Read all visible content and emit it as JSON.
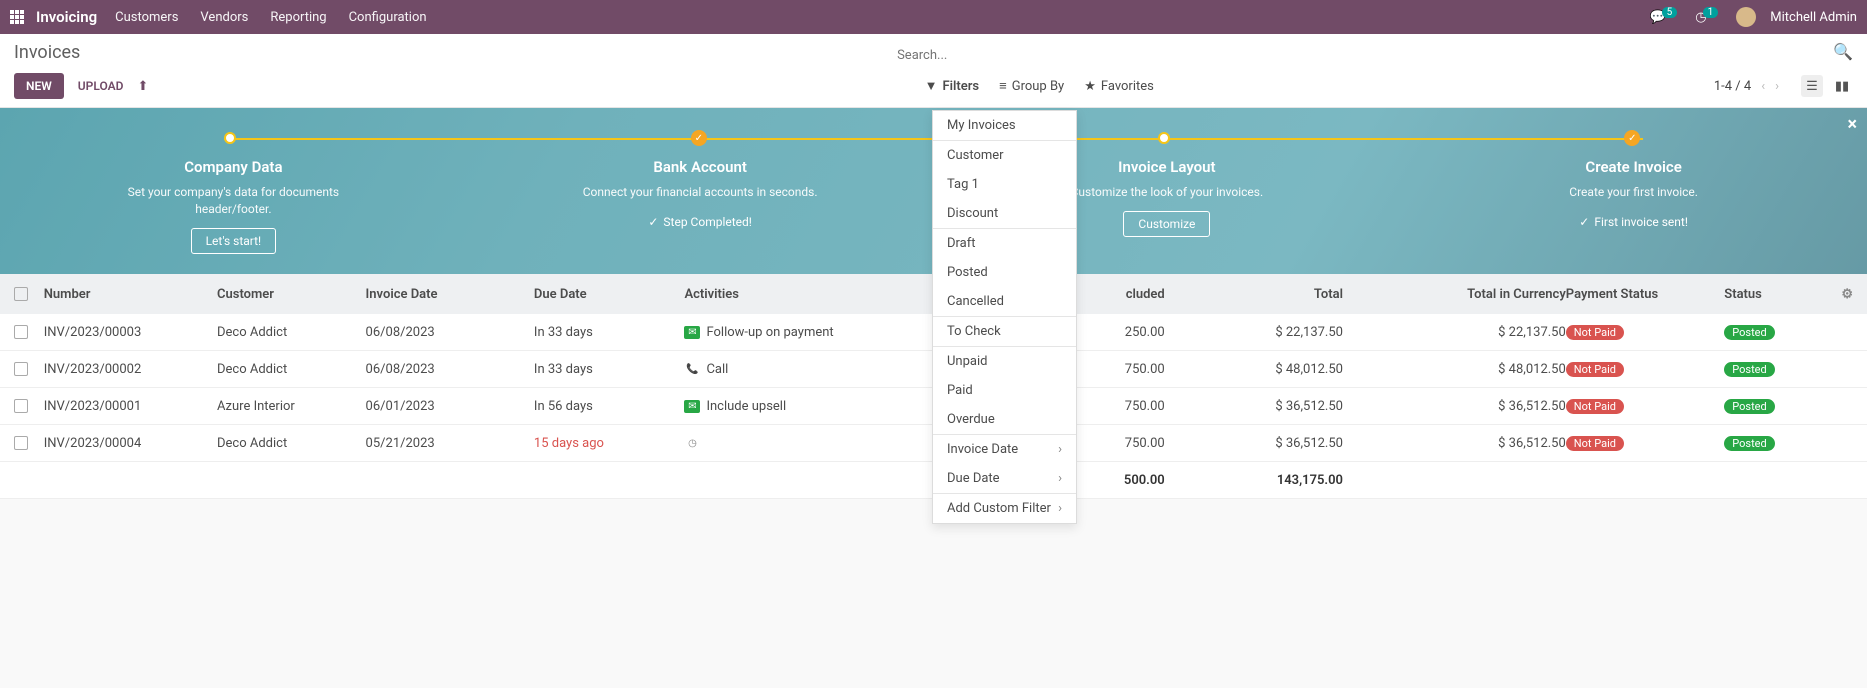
{
  "topbar": {
    "brand": "Invoicing",
    "menu": [
      "Customers",
      "Vendors",
      "Reporting",
      "Configuration"
    ],
    "msg_count": "5",
    "activity_count": "1",
    "user": "Mitchell Admin"
  },
  "page": {
    "title": "Invoices",
    "search_placeholder": "Search...",
    "btn_new": "NEW",
    "btn_upload": "UPLOAD"
  },
  "searchtools": {
    "filters": "Filters",
    "groupby": "Group By",
    "favorites": "Favorites",
    "pager": "1-4 / 4"
  },
  "banner": {
    "steps": [
      {
        "title": "Company Data",
        "desc": "Set your company's data for documents header/footer.",
        "action": "Let's start!",
        "done": false
      },
      {
        "title": "Bank Account",
        "desc": "Connect your financial accounts in seconds.",
        "done_label": "Step Completed!",
        "done": true
      },
      {
        "title": "Invoice Layout",
        "desc": "Customize the look of your invoices.",
        "action": "Customize",
        "done": false
      },
      {
        "title": "Create Invoice",
        "desc": "Create your first invoice.",
        "done_label": "First invoice sent!",
        "done": true
      }
    ]
  },
  "columns": {
    "num": "Number",
    "cust": "Customer",
    "idate": "Invoice Date",
    "ddate": "Due Date",
    "act": "Activities",
    "tax": "cluded",
    "total": "Total",
    "cur": "Total in Currency",
    "pay": "Payment Status",
    "stat": "Status"
  },
  "rows": [
    {
      "num": "INV/2023/00003",
      "cust": "Deco Addict",
      "idate": "06/08/2023",
      "ddate": "In 33 days",
      "overdue": false,
      "act_icon": "green",
      "act": "Follow-up on payment",
      "tax": "250.00",
      "total": "$ 22,137.50",
      "cur": "$ 22,137.50",
      "pay": "Not Paid",
      "stat": "Posted"
    },
    {
      "num": "INV/2023/00002",
      "cust": "Deco Addict",
      "idate": "06/08/2023",
      "ddate": "In 33 days",
      "overdue": false,
      "act_icon": "orange",
      "act": "Call",
      "tax": "750.00",
      "total": "$ 48,012.50",
      "cur": "$ 48,012.50",
      "pay": "Not Paid",
      "stat": "Posted"
    },
    {
      "num": "INV/2023/00001",
      "cust": "Azure Interior",
      "idate": "06/01/2023",
      "ddate": "In 56 days",
      "overdue": false,
      "act_icon": "green",
      "act": "Include upsell",
      "tax": "750.00",
      "total": "$ 36,512.50",
      "cur": "$ 36,512.50",
      "pay": "Not Paid",
      "stat": "Posted"
    },
    {
      "num": "INV/2023/00004",
      "cust": "Deco Addict",
      "idate": "05/21/2023",
      "ddate": "15 days ago",
      "overdue": true,
      "act_icon": "gray",
      "act": "",
      "tax": "750.00",
      "total": "$ 36,512.50",
      "cur": "$ 36,512.50",
      "pay": "Not Paid",
      "stat": "Posted"
    }
  ],
  "totals": {
    "tax": "500.00",
    "total": "143,175.00"
  },
  "filter_menu": {
    "group1": [
      "My Invoices"
    ],
    "group2": [
      "Customer",
      "Tag 1",
      "Discount"
    ],
    "group3": [
      "Draft",
      "Posted",
      "Cancelled"
    ],
    "group4": [
      "To Check"
    ],
    "group5": [
      "Unpaid",
      "Paid",
      "Overdue"
    ],
    "group6": [
      "Invoice Date",
      "Due Date"
    ],
    "group7": [
      "Add Custom Filter"
    ]
  }
}
